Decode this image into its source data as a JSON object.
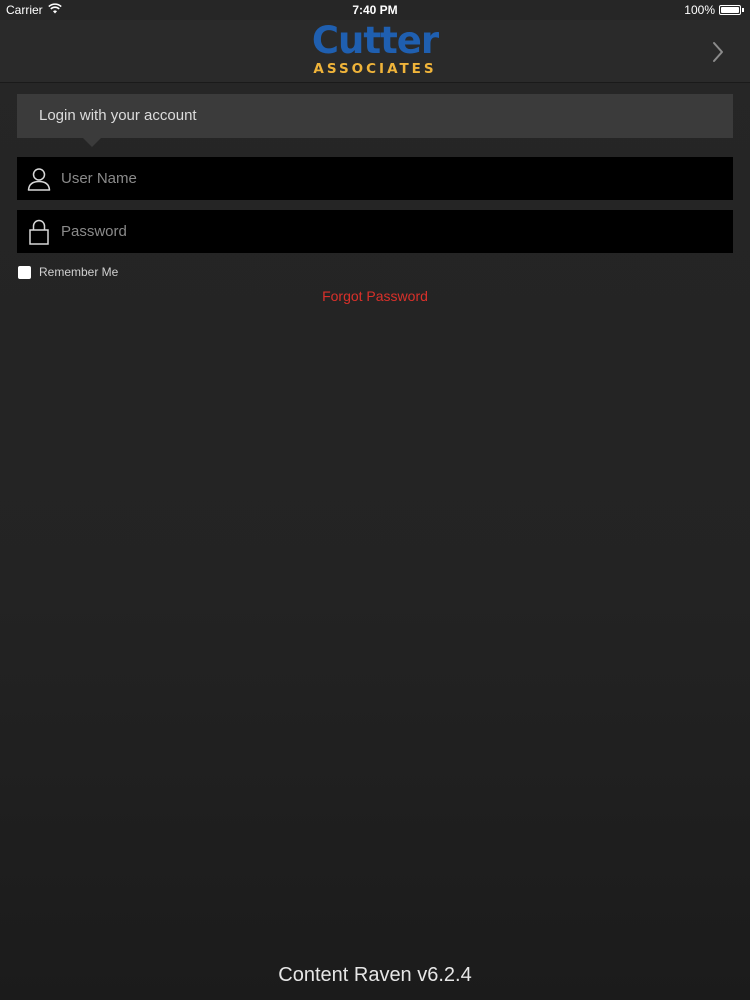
{
  "status_bar": {
    "carrier": "Carrier",
    "time": "7:40 PM",
    "battery_percent": "100%",
    "battery_level": 1.0,
    "wifi_icon": "wifi-icon",
    "battery_icon": "battery-icon"
  },
  "header": {
    "logo_main": "Cutter",
    "logo_sub": "ASSOCIATES",
    "logo_main_color": "#1f5fb0",
    "logo_sub_color": "#f0b43a",
    "next_icon": "chevron-right-icon"
  },
  "login": {
    "header_label": "Login with your account",
    "username": {
      "placeholder": "User Name",
      "value": "",
      "icon": "user-icon"
    },
    "password": {
      "placeholder": "Password",
      "value": "",
      "icon": "lock-icon"
    },
    "remember_me_label": "Remember Me",
    "remember_me_checked": false,
    "forgot_password_label": "Forgot Password",
    "forgot_password_color": "#d9302a"
  },
  "footer": {
    "version": "Content Raven v6.2.4"
  }
}
